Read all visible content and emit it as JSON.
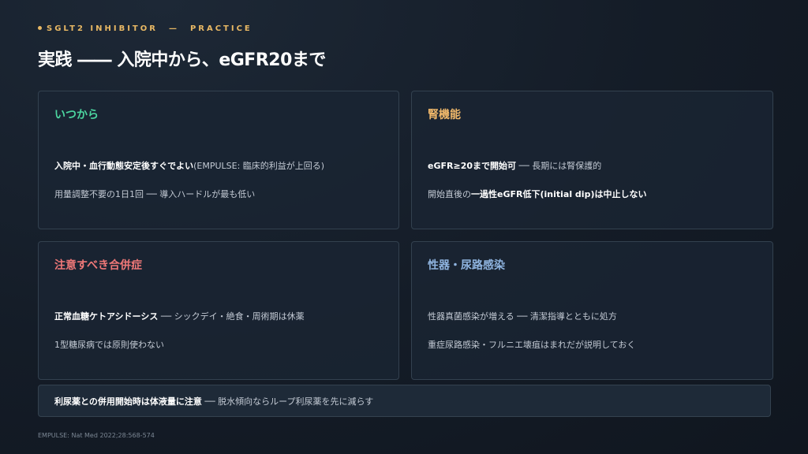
{
  "header": {
    "eyebrow_left": "SGLT2 INHIBITOR",
    "eyebrow_sep": "—",
    "eyebrow_right": "PRACTICE",
    "title": "実践 ―― 入院中から、eGFR20まで"
  },
  "cards": [
    {
      "title": "いつから",
      "accent": "#4cd6a0",
      "lines": [
        {
          "bold": "入院中・血行動態安定後すぐでよい",
          "rest": "(EMPULSE: 臨床的利益が上回る)"
        },
        {
          "bold": "",
          "rest": "用量調整不要の1日1回 ── 導入ハードルが最も低い"
        }
      ]
    },
    {
      "title": "腎機能",
      "accent": "#f0b86a",
      "lines": [
        {
          "bold": "eGFR≥20まで開始可",
          "rest": " ── 長期には腎保護的"
        },
        {
          "pre": "開始直後の",
          "bold": "一過性eGFR低下(initial dip)は中止しない",
          "rest": ""
        }
      ]
    },
    {
      "title": "注意すべき合併症",
      "accent": "#f07878",
      "lines": [
        {
          "bold": "正常血糖ケトアシドーシス",
          "rest": " ── シックデイ・絶食・周術期は休薬"
        },
        {
          "bold": "",
          "rest": "1型糖尿病では原則使わない"
        }
      ]
    },
    {
      "title": "性器・尿路感染",
      "accent": "#8fb4e0",
      "lines": [
        {
          "bold": "",
          "rest": "性器真菌感染が増える ── 清潔指導とともに処方"
        },
        {
          "bold": "",
          "rest": "重症尿路感染・フルニエ壊疽はまれだが説明しておく"
        }
      ]
    }
  ],
  "note": {
    "bold": "利尿薬との併用開始時は体液量に注意",
    "rest": " ── 脱水傾向ならループ利尿薬を先に減らす"
  },
  "footer": "EMPULSE: Nat Med 2022;28:568-574"
}
